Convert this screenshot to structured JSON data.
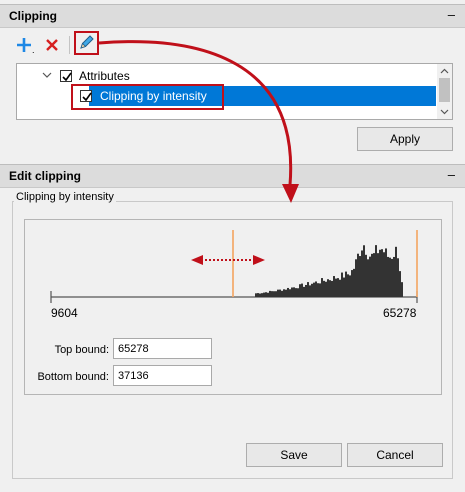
{
  "clipping_panel": {
    "title": "Clipping",
    "collapse_glyph": "–",
    "toolbar": {
      "add_icon": "plus-icon",
      "delete_icon": "red-x-icon",
      "edit_icon": "pencil-icon"
    },
    "tree": {
      "root_label": "Attributes",
      "child_label": "Clipping by intensity",
      "root_checked": true,
      "child_checked": true
    },
    "apply_label": "Apply"
  },
  "edit_panel": {
    "title": "Edit clipping",
    "collapse_glyph": "–",
    "group_title": "Clipping by intensity",
    "histogram": {
      "min_label": "9604",
      "max_label": "65278",
      "min_value": 9604,
      "max_value": 65278,
      "lower_marker": 37136,
      "upper_marker": 65278
    },
    "top_bound_label": "Top bound:",
    "top_bound_value": "65278",
    "bottom_bound_label": "Bottom bound:",
    "bottom_bound_value": "37136",
    "save_label": "Save",
    "cancel_label": "Cancel"
  },
  "colors": {
    "annotation_red": "#c0101a",
    "selection_blue": "#0078d7",
    "marker_orange": "#f4a460",
    "histogram_fill": "#333333"
  }
}
